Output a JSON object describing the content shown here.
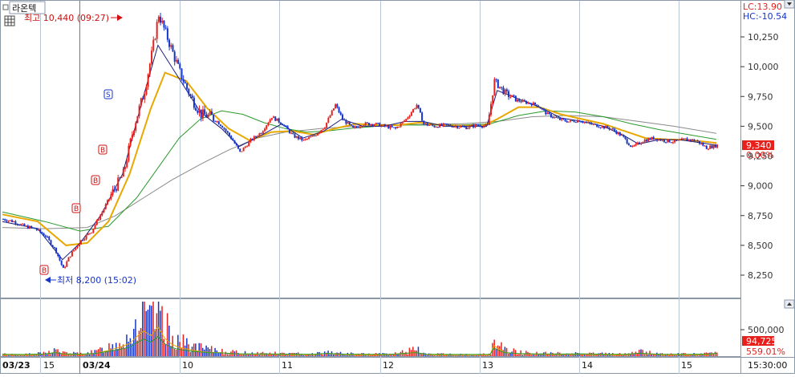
{
  "header": {
    "menu_glyph": "□",
    "stock_name": "라온텍",
    "lc_text": "LC:13.90",
    "hc_text": "HC:-10.54"
  },
  "annotations": {
    "high_text": "최고 10,440 (09:27)",
    "low_text": "최저 8,200 (15:02)",
    "current_price": "9,340",
    "current_change": "0.00%",
    "current_volume": "94,725",
    "volume_ratio": "559.01%",
    "marker_buy": "B",
    "marker_sell": "S"
  },
  "colors": {
    "up": "#e8201c",
    "down": "#1634c8",
    "ma_fast": "#1a1a7a",
    "ma_mid": "#e8a800",
    "ma_slow": "#2a9a2a",
    "ma_long": "#8a8a8a",
    "axis": "#333333",
    "grid_v": "#b9c6d6",
    "price_box": "#e8201c",
    "volume_box": "#e8201c"
  },
  "chart_data": {
    "type": "candlestick",
    "y_axis": {
      "ticks": [
        10250,
        10000,
        9750,
        9500,
        9250,
        9000,
        8750,
        8500,
        8250
      ],
      "tick_labels": [
        "10,250",
        "10,000",
        "9,750",
        "9,500",
        "9,250",
        "9,000",
        "8,750",
        "8,500",
        "8,250"
      ]
    },
    "x_axis": {
      "labels": [
        "03/23",
        "15",
        "03/24",
        "10",
        "11",
        "12",
        "13",
        "14",
        "15",
        "15:30:00"
      ]
    },
    "price_path": [
      [
        0,
        8720
      ],
      [
        3,
        8700
      ],
      [
        6,
        8660
      ],
      [
        9,
        8640
      ],
      [
        12,
        8580
      ],
      [
        15,
        8450
      ],
      [
        17,
        8300
      ],
      [
        19,
        8420
      ],
      [
        22,
        8540
      ],
      [
        25,
        8620
      ],
      [
        28,
        8780
      ],
      [
        31,
        8950
      ],
      [
        34,
        9100
      ],
      [
        37,
        9500
      ],
      [
        40,
        9800
      ],
      [
        42,
        10100
      ],
      [
        44,
        10440
      ],
      [
        47,
        10200
      ],
      [
        50,
        9950
      ],
      [
        53,
        9750
      ],
      [
        56,
        9600
      ],
      [
        59,
        9580
      ],
      [
        62,
        9500
      ],
      [
        65,
        9380
      ],
      [
        67,
        9280
      ],
      [
        70,
        9380
      ],
      [
        73,
        9450
      ],
      [
        76,
        9580
      ],
      [
        79,
        9520
      ],
      [
        82,
        9420
      ],
      [
        85,
        9380
      ],
      [
        88,
        9420
      ],
      [
        91,
        9500
      ],
      [
        94,
        9680
      ],
      [
        96,
        9560
      ],
      [
        99,
        9480
      ],
      [
        102,
        9520
      ],
      [
        105,
        9520
      ],
      [
        108,
        9500
      ],
      [
        111,
        9480
      ],
      [
        114,
        9560
      ],
      [
        117,
        9680
      ],
      [
        119,
        9520
      ],
      [
        122,
        9500
      ],
      [
        125,
        9510
      ],
      [
        128,
        9500
      ],
      [
        131,
        9490
      ],
      [
        134,
        9510
      ],
      [
        137,
        9500
      ],
      [
        139,
        9880
      ],
      [
        142,
        9780
      ],
      [
        145,
        9720
      ],
      [
        148,
        9700
      ],
      [
        151,
        9680
      ],
      [
        154,
        9600
      ],
      [
        157,
        9560
      ],
      [
        160,
        9540
      ],
      [
        163,
        9550
      ],
      [
        166,
        9520
      ],
      [
        169,
        9500
      ],
      [
        172,
        9480
      ],
      [
        175,
        9420
      ],
      [
        178,
        9320
      ],
      [
        181,
        9380
      ],
      [
        184,
        9400
      ],
      [
        187,
        9380
      ],
      [
        190,
        9370
      ],
      [
        193,
        9390
      ],
      [
        196,
        9380
      ],
      [
        199,
        9320
      ],
      [
        202,
        9340
      ]
    ],
    "ma_fast": [
      [
        0,
        8700
      ],
      [
        10,
        8640
      ],
      [
        17,
        8380
      ],
      [
        22,
        8520
      ],
      [
        28,
        8760
      ],
      [
        34,
        9100
      ],
      [
        40,
        9760
      ],
      [
        44,
        10180
      ],
      [
        50,
        9900
      ],
      [
        56,
        9620
      ],
      [
        62,
        9480
      ],
      [
        67,
        9330
      ],
      [
        73,
        9420
      ],
      [
        79,
        9520
      ],
      [
        85,
        9400
      ],
      [
        91,
        9460
      ],
      [
        96,
        9560
      ],
      [
        102,
        9500
      ],
      [
        108,
        9500
      ],
      [
        114,
        9540
      ],
      [
        119,
        9540
      ],
      [
        125,
        9500
      ],
      [
        131,
        9500
      ],
      [
        137,
        9500
      ],
      [
        140,
        9800
      ],
      [
        146,
        9730
      ],
      [
        152,
        9660
      ],
      [
        158,
        9570
      ],
      [
        164,
        9540
      ],
      [
        170,
        9500
      ],
      [
        176,
        9420
      ],
      [
        180,
        9350
      ],
      [
        186,
        9390
      ],
      [
        192,
        9385
      ],
      [
        198,
        9360
      ],
      [
        202,
        9340
      ]
    ],
    "ma_mid": [
      [
        0,
        8760
      ],
      [
        10,
        8700
      ],
      [
        18,
        8500
      ],
      [
        24,
        8520
      ],
      [
        30,
        8700
      ],
      [
        36,
        9100
      ],
      [
        42,
        9650
      ],
      [
        46,
        9950
      ],
      [
        52,
        9880
      ],
      [
        58,
        9650
      ],
      [
        64,
        9480
      ],
      [
        70,
        9380
      ],
      [
        76,
        9450
      ],
      [
        82,
        9460
      ],
      [
        88,
        9430
      ],
      [
        94,
        9480
      ],
      [
        100,
        9520
      ],
      [
        106,
        9510
      ],
      [
        112,
        9510
      ],
      [
        118,
        9530
      ],
      [
        124,
        9510
      ],
      [
        130,
        9505
      ],
      [
        136,
        9505
      ],
      [
        140,
        9560
      ],
      [
        146,
        9660
      ],
      [
        152,
        9660
      ],
      [
        158,
        9600
      ],
      [
        164,
        9560
      ],
      [
        170,
        9520
      ],
      [
        176,
        9460
      ],
      [
        182,
        9400
      ],
      [
        188,
        9390
      ],
      [
        194,
        9385
      ],
      [
        202,
        9360
      ]
    ],
    "ma_slow": [
      [
        0,
        8780
      ],
      [
        12,
        8700
      ],
      [
        22,
        8620
      ],
      [
        30,
        8660
      ],
      [
        38,
        8900
      ],
      [
        44,
        9150
      ],
      [
        50,
        9400
      ],
      [
        56,
        9560
      ],
      [
        62,
        9630
      ],
      [
        68,
        9600
      ],
      [
        74,
        9530
      ],
      [
        80,
        9480
      ],
      [
        86,
        9450
      ],
      [
        92,
        9460
      ],
      [
        98,
        9480
      ],
      [
        106,
        9500
      ],
      [
        114,
        9510
      ],
      [
        122,
        9510
      ],
      [
        130,
        9510
      ],
      [
        138,
        9520
      ],
      [
        146,
        9590
      ],
      [
        154,
        9630
      ],
      [
        162,
        9620
      ],
      [
        170,
        9580
      ],
      [
        178,
        9520
      ],
      [
        186,
        9470
      ],
      [
        194,
        9430
      ],
      [
        202,
        9390
      ]
    ],
    "ma_long": [
      [
        0,
        8650
      ],
      [
        12,
        8640
      ],
      [
        24,
        8650
      ],
      [
        32,
        8750
      ],
      [
        40,
        8900
      ],
      [
        48,
        9050
      ],
      [
        56,
        9180
      ],
      [
        64,
        9300
      ],
      [
        72,
        9400
      ],
      [
        80,
        9450
      ],
      [
        90,
        9480
      ],
      [
        100,
        9500
      ],
      [
        110,
        9510
      ],
      [
        120,
        9515
      ],
      [
        130,
        9520
      ],
      [
        140,
        9540
      ],
      [
        150,
        9580
      ],
      [
        160,
        9590
      ],
      [
        170,
        9580
      ],
      [
        180,
        9540
      ],
      [
        190,
        9500
      ],
      [
        202,
        9440
      ]
    ],
    "volume_axis": {
      "tick_label": "500,000"
    },
    "volume_path": [
      [
        0,
        12
      ],
      [
        6,
        10
      ],
      [
        12,
        18
      ],
      [
        15,
        40
      ],
      [
        17,
        20
      ],
      [
        22,
        15
      ],
      [
        26,
        25
      ],
      [
        30,
        60
      ],
      [
        33,
        90
      ],
      [
        36,
        130
      ],
      [
        38,
        200
      ],
      [
        40,
        260
      ],
      [
        42,
        210
      ],
      [
        44,
        300
      ],
      [
        46,
        180
      ],
      [
        48,
        120
      ],
      [
        50,
        90
      ],
      [
        54,
        60
      ],
      [
        58,
        40
      ],
      [
        62,
        35
      ],
      [
        66,
        22
      ],
      [
        70,
        20
      ],
      [
        76,
        18
      ],
      [
        82,
        15
      ],
      [
        88,
        14
      ],
      [
        92,
        28
      ],
      [
        96,
        15
      ],
      [
        104,
        12
      ],
      [
        110,
        14
      ],
      [
        117,
        40
      ],
      [
        120,
        14
      ],
      [
        126,
        10
      ],
      [
        132,
        10
      ],
      [
        138,
        12
      ],
      [
        139,
        110
      ],
      [
        142,
        40
      ],
      [
        146,
        25
      ],
      [
        152,
        18
      ],
      [
        158,
        16
      ],
      [
        164,
        20
      ],
      [
        170,
        14
      ],
      [
        176,
        12
      ],
      [
        180,
        30
      ],
      [
        186,
        14
      ],
      [
        194,
        12
      ],
      [
        200,
        16
      ],
      [
        202,
        30
      ]
    ]
  }
}
